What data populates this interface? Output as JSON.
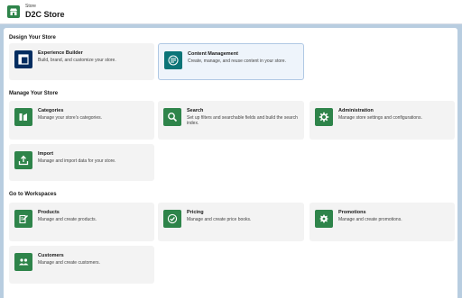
{
  "header": {
    "breadcrumb": "Store",
    "title": "D2C Store",
    "icon": "store-icon"
  },
  "colors": {
    "green": "#2e844a",
    "navy": "#032d60",
    "teal": "#0b7477",
    "page_bg": "#b8cde0"
  },
  "sections": {
    "design": {
      "title": "Design Your Store",
      "cards": [
        {
          "title": "Experience Builder",
          "desc": "Build, brand, and customize your store.",
          "icon": "layout-icon"
        },
        {
          "title": "Content Management",
          "desc": "Create, manage, and reuse content in your store.",
          "icon": "content-icon"
        }
      ]
    },
    "manage": {
      "title": "Manage Your Store",
      "cards": [
        {
          "title": "Categories",
          "desc": "Manage your store's categories.",
          "icon": "categories-icon"
        },
        {
          "title": "Search",
          "desc": "Set up filters and searchable fields and build the search index.",
          "icon": "search-icon"
        },
        {
          "title": "Administration",
          "desc": "Manage store settings and configurations.",
          "icon": "gear-icon"
        },
        {
          "title": "Import",
          "desc": "Manage and import data for your store.",
          "icon": "upload-icon"
        }
      ]
    },
    "workspaces": {
      "title": "Go to Workspaces",
      "cards": [
        {
          "title": "Products",
          "desc": "Manage and create products.",
          "icon": "products-icon"
        },
        {
          "title": "Pricing",
          "desc": "Manage and create price books.",
          "icon": "pricing-icon"
        },
        {
          "title": "Promotions",
          "desc": "Manage and create promotions.",
          "icon": "promotions-icon"
        },
        {
          "title": "Customers",
          "desc": "Manage and create customers.",
          "icon": "customers-icon"
        }
      ]
    }
  }
}
